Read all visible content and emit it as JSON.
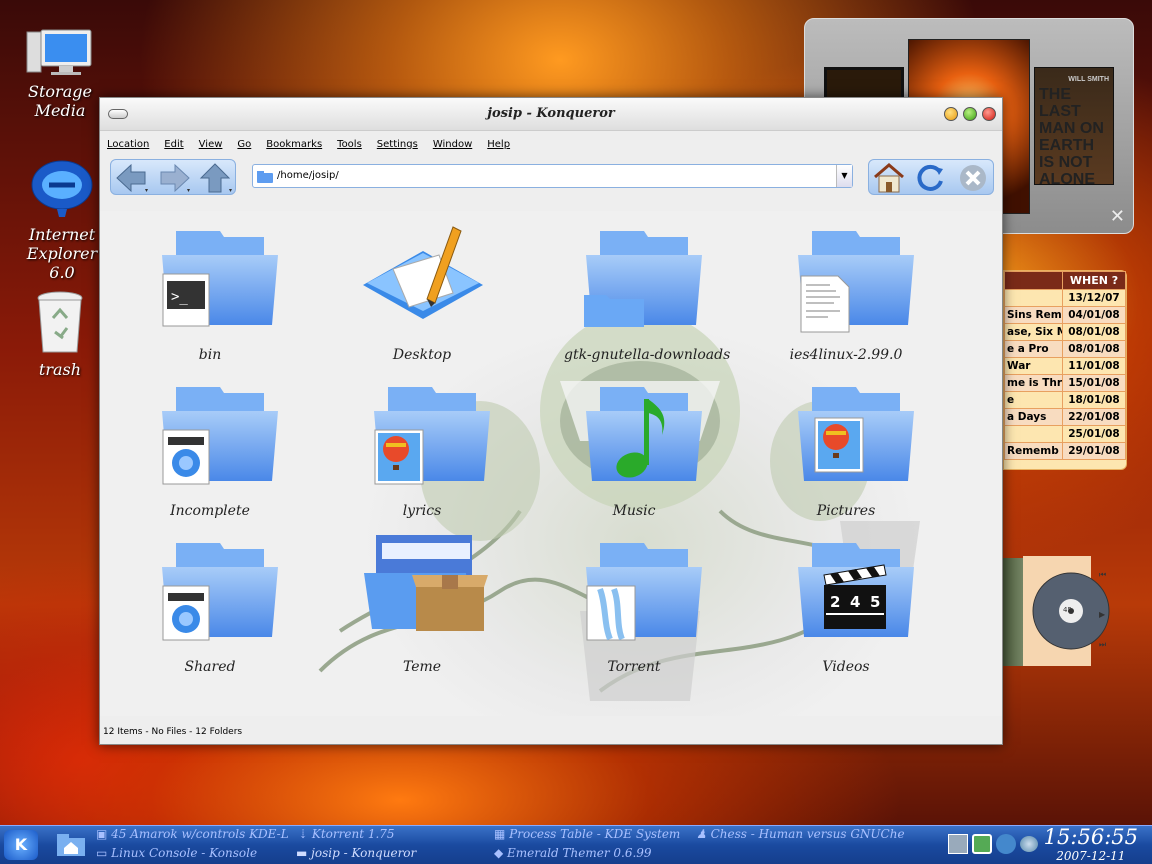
{
  "desktop": {
    "icons": [
      {
        "label": "Storage\nMedia",
        "line1": "Storage",
        "line2": "Media"
      },
      {
        "label": "Internet Explorer 6.0",
        "line1": "Internet",
        "line2": "Explorer 6.0"
      },
      {
        "label": "trash",
        "line1": "trash",
        "line2": ""
      }
    ]
  },
  "window": {
    "title": "josip - Konqueror",
    "menu": [
      "Location",
      "Edit",
      "View",
      "Go",
      "Bookmarks",
      "Tools",
      "Settings",
      "Window",
      "Help"
    ],
    "address": "/home/josip/",
    "status": "12 Items - No Files - 12 Folders",
    "items": [
      {
        "label": "bin",
        "badge": "terminal-icon"
      },
      {
        "label": "Desktop",
        "badge": "desktop-icon"
      },
      {
        "label": "gtk-gnutella-downloads",
        "badge": "folder-icon"
      },
      {
        "label": "ies4linux-2.99.0",
        "badge": "document-icon"
      },
      {
        "label": "Incomplete",
        "badge": "video-icon"
      },
      {
        "label": "lyrics",
        "badge": "balloon-image-icon"
      },
      {
        "label": "Music",
        "badge": "music-note-icon"
      },
      {
        "label": "Pictures",
        "badge": "balloon-image-icon"
      },
      {
        "label": "Shared",
        "badge": "video-icon"
      },
      {
        "label": "Teme",
        "badge": "package-icon"
      },
      {
        "label": "Torrent",
        "badge": "torrent-icon"
      },
      {
        "label": "Videos",
        "badge": "clapperboard-icon"
      }
    ],
    "clapper_numbers": [
      "2",
      "4",
      "5"
    ]
  },
  "calendar": {
    "header": "WHEN ?",
    "rows": [
      {
        "title": "",
        "date": "13/12/07"
      },
      {
        "title": "Sins Rem",
        "date": "04/01/08"
      },
      {
        "title": "ase, Six Mon",
        "date": "08/01/08"
      },
      {
        "title": "e a Pro",
        "date": "08/01/08"
      },
      {
        "title": "War",
        "date": "11/01/08"
      },
      {
        "title": "me is Thr",
        "date": "15/01/08"
      },
      {
        "title": "e",
        "date": "18/01/08"
      },
      {
        "title": "a Days",
        "date": "22/01/08"
      },
      {
        "title": "",
        "date": "25/01/08"
      },
      {
        "title": "Rememb",
        "date": "29/01/08"
      }
    ]
  },
  "posters": {
    "poster3_text": "THE LAST MAN ON EARTH IS NOT ALONE",
    "poster3_top": "WILL SMITH"
  },
  "cd_label": "45",
  "panel": {
    "tasks": [
      {
        "label": "45 Amarok w/controls KDE-L"
      },
      {
        "label": "Linux Console - Konsole"
      },
      {
        "label": "Ktorrent 1.75"
      },
      {
        "label": "Process Table - KDE System"
      },
      {
        "label": "Emerald Themer 0.6.99"
      },
      {
        "label": "Chess - Human versus GNUChe"
      },
      {
        "label": "josip - Konqueror"
      }
    ],
    "time": "15:56:55",
    "date": "2007-12-11"
  },
  "colors": {
    "panel": "#1a4aa0",
    "folder": "#5d9cf0",
    "calendar_bg": "#fde6b0"
  }
}
